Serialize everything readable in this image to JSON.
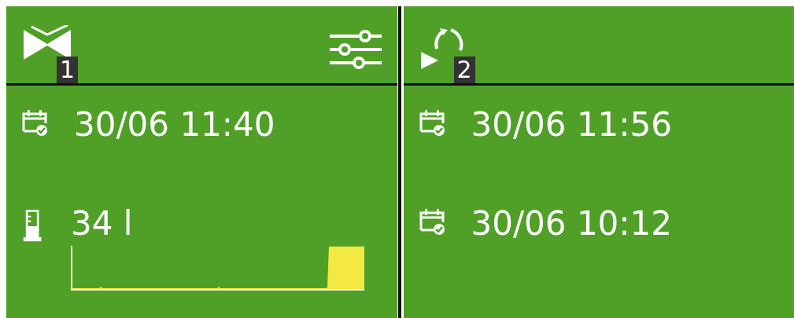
{
  "panels": [
    {
      "kind": "valve",
      "badge": "1",
      "settings": true,
      "rows": [
        {
          "kind": "date",
          "text": "30/06 11:40"
        },
        {
          "kind": "volume",
          "text": "34 l"
        }
      ]
    },
    {
      "kind": "cycle",
      "badge": "2",
      "settings": false,
      "rows": [
        {
          "kind": "date",
          "text": "30/06 11:56"
        },
        {
          "kind": "date",
          "text": "30/06 10:12"
        }
      ]
    }
  ]
}
